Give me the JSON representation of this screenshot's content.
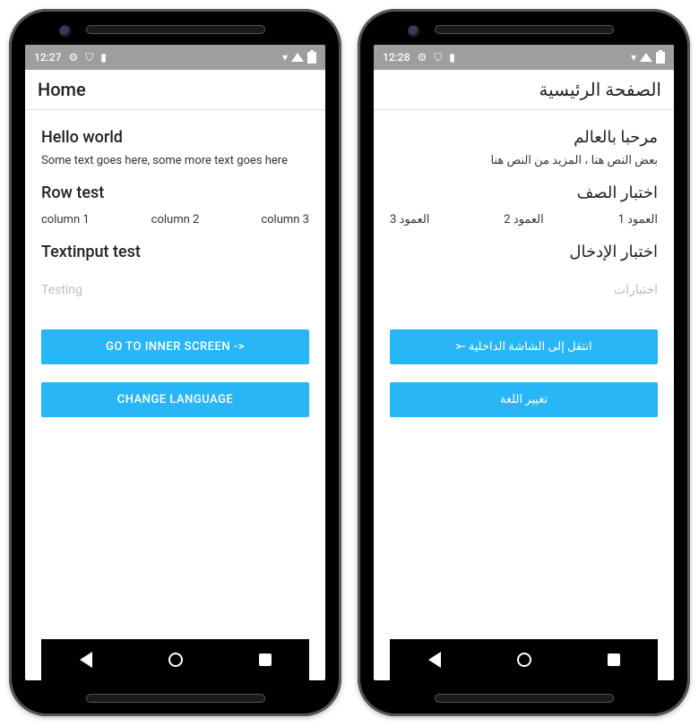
{
  "colors": {
    "accent": "#29b6f6",
    "statusbar": "#9e9e9e"
  },
  "left": {
    "status": {
      "time": "12:27",
      "icons": [
        "gear-icon",
        "shield-icon",
        "sim-icon",
        "wifi-icon",
        "signal-icon",
        "battery-icon"
      ]
    },
    "appbar_title": "Home",
    "hello_heading": "Hello world",
    "hello_body": "Some text goes here, some more text goes here",
    "row_heading": "Row test",
    "columns": [
      "column 1",
      "column 2",
      "column 3"
    ],
    "textinput_heading": "Textinput test",
    "textinput_placeholder": "Testing",
    "inner_button": "GO TO INNER SCREEN ->",
    "lang_button": "CHANGE LANGUAGE"
  },
  "right": {
    "status": {
      "time": "12:28",
      "icons": [
        "gear-icon",
        "shield-icon",
        "sim-icon",
        "wifi-icon",
        "signal-icon",
        "battery-icon"
      ]
    },
    "appbar_title": "الصفحة الرئيسية",
    "hello_heading": "مرحبا بالعالم",
    "hello_body": "بعض النص هنا ، المزيد من النص هنا",
    "row_heading": "اختبار الصف",
    "columns": [
      "العمود 1",
      "العمود 2",
      "العمود 3"
    ],
    "textinput_heading": "اختبار الإدخال",
    "textinput_placeholder": "اختبارات",
    "inner_button": "انتقل إلى الشاشة الداخلية -<",
    "lang_button": "تغيير اللغة"
  }
}
